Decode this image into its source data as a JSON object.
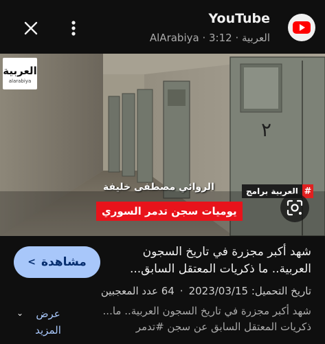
{
  "header": {
    "app_title": "YouTube",
    "channel_line": "AlArabiya · العربية · 3:12"
  },
  "video": {
    "badge_main": "العربية",
    "badge_sub": "alarabiya",
    "program_tag": "العربية برامج",
    "program_hash": "#",
    "guest_name": "الروائي مصطفى خليفة",
    "episode_title": "يوميات سجن تدمر السوري",
    "door_number": "٢"
  },
  "info": {
    "watch_label": "مشاهدة",
    "title": "شهد أكبر مجزرة في تاريخ السجون العربية.. ما ذكريات المعتقل السابق...",
    "upload_label": "تاريخ التحميل: 2023/03/15",
    "likes_label": "64 عدد المعجبين",
    "description": "شهد أكبر مجزرة في تاريخ السجون العربية.. ما... ذكريات المعتقل السابق عن سجن #تدمر",
    "more_label": "عرض المزيد"
  },
  "colors": {
    "background": "#0f0f0f",
    "youtube_red": "#ff0000",
    "accent_blue": "#a8c7fa",
    "episode_red": "#e8131b"
  },
  "icons": [
    "youtube-logo-icon",
    "close-icon",
    "more-vert-icon",
    "lens-icon",
    "chevron-left-icon",
    "chevron-down-icon"
  ]
}
